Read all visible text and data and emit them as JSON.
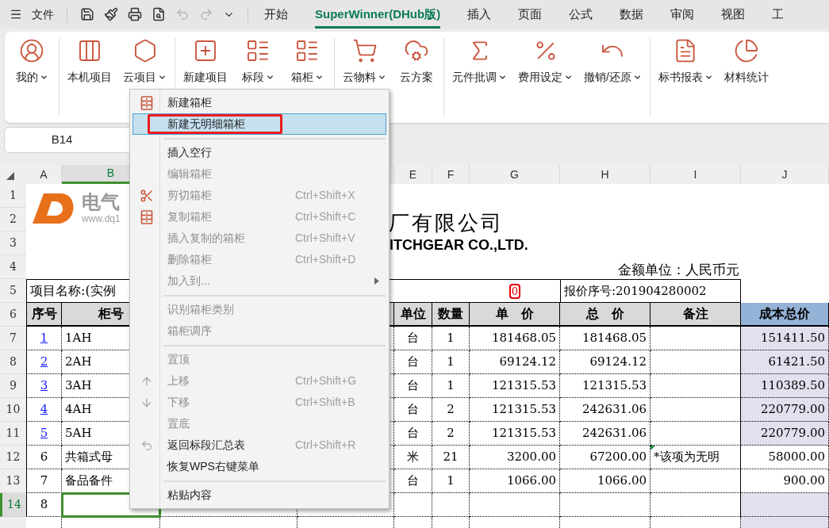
{
  "topbar": {
    "file_menu": "文件",
    "quick_actions": [
      {
        "disabled": false
      },
      {
        "disabled": false
      },
      {
        "disabled": false
      },
      {
        "disabled": false
      },
      {
        "disabled": true
      },
      {
        "disabled": true
      },
      {
        "disabled": false
      }
    ],
    "tabs": [
      {
        "label": "开始",
        "selected": false
      },
      {
        "label": "SuperWinner(DHub版)",
        "selected": true
      },
      {
        "label": "插入",
        "selected": false
      },
      {
        "label": "页面",
        "selected": false
      },
      {
        "label": "公式",
        "selected": false
      },
      {
        "label": "数据",
        "selected": false
      },
      {
        "label": "审阅",
        "selected": false
      },
      {
        "label": "视图",
        "selected": false
      },
      {
        "label": "工",
        "selected": false
      }
    ]
  },
  "ribbon": {
    "groups": [
      {
        "buttons": [
          {
            "label": "我的",
            "dropdown": true
          }
        ]
      },
      {
        "buttons": [
          {
            "label": "本机项目",
            "dropdown": false
          },
          {
            "label": "云项目",
            "dropdown": true
          }
        ]
      },
      {
        "buttons": [
          {
            "label": "新建项目",
            "dropdown": false
          },
          {
            "label": "标段",
            "dropdown": true
          },
          {
            "label": "箱柜",
            "dropdown": true
          }
        ]
      },
      {
        "buttons": [
          {
            "label": "云物料",
            "dropdown": true
          },
          {
            "label": "云方案",
            "dropdown": false
          }
        ]
      },
      {
        "buttons": [
          {
            "label": "元件批调",
            "dropdown": true
          },
          {
            "label": "费用设定",
            "dropdown": true
          },
          {
            "label": "撤销/还原",
            "dropdown": true
          }
        ]
      },
      {
        "buttons": [
          {
            "label": "标书报表",
            "dropdown": true
          },
          {
            "label": "材料统计",
            "dropdown": false
          }
        ]
      }
    ]
  },
  "name_box": "B14",
  "sheet": {
    "columns": [
      {
        "label": "A",
        "selected": false
      },
      {
        "label": "B",
        "selected": true
      },
      {
        "label": "E",
        "selected": false
      },
      {
        "label": "F",
        "selected": false
      },
      {
        "label": "G",
        "selected": false
      },
      {
        "label": "H",
        "selected": false
      },
      {
        "label": "I",
        "selected": false
      },
      {
        "label": "J",
        "selected": false
      }
    ],
    "row_numbers": [
      {
        "label": "1",
        "selected": false
      },
      {
        "label": "2",
        "selected": false
      },
      {
        "label": "3",
        "selected": false
      },
      {
        "label": "4",
        "selected": false
      },
      {
        "label": "5",
        "selected": false
      },
      {
        "label": "6",
        "selected": false
      },
      {
        "label": "7",
        "selected": false
      },
      {
        "label": "8",
        "selected": false
      },
      {
        "label": "9",
        "selected": false
      },
      {
        "label": "10",
        "selected": false
      },
      {
        "label": "11",
        "selected": false
      },
      {
        "label": "12",
        "selected": false
      },
      {
        "label": "13",
        "selected": false
      },
      {
        "label": "14",
        "selected": true
      }
    ],
    "title_block": {
      "logo_name": "电气",
      "logo_site": "www.dq1",
      "company_cn": "厂有限公司",
      "company_en": "ITCHGEAR CO.,LTD.",
      "currency_note": "金额单位：人民币元",
      "project_label": "项目名称:(实例",
      "marker": "0",
      "quote_no": "报价序号:201904280002"
    },
    "table": {
      "headers": [
        "序号",
        "柜号",
        "单位",
        "数量",
        "单　价",
        "总　价",
        "备注",
        "成本总价"
      ],
      "rows": [
        {
          "no": "1",
          "link": true,
          "name": "1AH",
          "unit": "台",
          "qty": "1",
          "price": "181468.05",
          "total": "181468.05",
          "cost": "151411.50",
          "shaded": true,
          "flag": false,
          "selected": false
        },
        {
          "no": "2",
          "link": true,
          "name": "2AH",
          "unit": "台",
          "qty": "1",
          "price": "69124.12",
          "total": "69124.12",
          "cost": "61421.50",
          "shaded": true,
          "flag": false,
          "selected": false
        },
        {
          "no": "3",
          "link": true,
          "name": "3AH",
          "unit": "台",
          "qty": "1",
          "price": "121315.53",
          "total": "121315.53",
          "cost": "110389.50",
          "shaded": true,
          "flag": false,
          "selected": false
        },
        {
          "no": "4",
          "link": true,
          "name": "4AH",
          "unit": "台",
          "qty": "2",
          "price": "121315.53",
          "total": "242631.06",
          "cost": "220779.00",
          "shaded": true,
          "flag": false,
          "selected": false
        },
        {
          "no": "5",
          "link": true,
          "name": "5AH",
          "unit": "台",
          "qty": "2",
          "price": "121315.53",
          "total": "242631.06",
          "cost": "220779.00",
          "shaded": true,
          "flag": false,
          "selected": false
        },
        {
          "no": "6",
          "link": false,
          "name": "共箱式母",
          "unit": "米",
          "qty": "21",
          "price": "3200.00",
          "total": "67200.00",
          "note": "*该项为无明",
          "cost": "58000.00",
          "shaded": false,
          "flag": true,
          "selected": false
        },
        {
          "no": "7",
          "link": false,
          "name": "备品备件",
          "unit": "台",
          "qty": "1",
          "price": "1066.00",
          "total": "1066.00",
          "cost": "900.00",
          "shaded": false,
          "flag": false,
          "selected": false
        },
        {
          "no": "8",
          "link": false,
          "shaded": true,
          "flag": false,
          "selected": true
        }
      ]
    }
  },
  "context_menu": {
    "items": [
      {
        "kind": "item",
        "label": "新建箱柜",
        "disabled": false,
        "selected": false,
        "annotated": false
      },
      {
        "kind": "item",
        "label": "新建无明细箱柜",
        "disabled": false,
        "selected": true,
        "annotated": true
      },
      {
        "kind": "separator"
      },
      {
        "kind": "item",
        "label": "插入空行",
        "disabled": false,
        "selected": false,
        "annotated": false
      },
      {
        "kind": "item",
        "label": "编辑箱柜",
        "disabled": true,
        "selected": false,
        "annotated": false
      },
      {
        "kind": "item",
        "label": "剪切箱柜",
        "shortcut": "Ctrl+Shift+X",
        "disabled": true,
        "selected": false,
        "annotated": false
      },
      {
        "kind": "item",
        "label": "复制箱柜",
        "shortcut": "Ctrl+Shift+C",
        "disabled": true,
        "selected": false,
        "annotated": false
      },
      {
        "kind": "item",
        "label": "插入复制的箱柜",
        "shortcut": "Ctrl+Shift+V",
        "disabled": true,
        "selected": false,
        "annotated": false
      },
      {
        "kind": "item",
        "label": "删除箱柜",
        "shortcut": "Ctrl+Shift+D",
        "disabled": true,
        "selected": false,
        "annotated": false
      },
      {
        "kind": "item",
        "label": "加入到...",
        "disabled": true,
        "selected": false,
        "annotated": false,
        "submenu": true
      },
      {
        "kind": "separator"
      },
      {
        "kind": "item",
        "label": "识别箱柜类别",
        "disabled": true,
        "selected": false,
        "annotated": false
      },
      {
        "kind": "item",
        "label": "箱柜调序",
        "disabled": true,
        "selected": false,
        "annotated": false
      },
      {
        "kind": "separator"
      },
      {
        "kind": "item",
        "label": "置顶",
        "disabled": true,
        "selected": false,
        "annotated": false
      },
      {
        "kind": "item",
        "label": "上移",
        "shortcut": "Ctrl+Shift+G",
        "disabled": true,
        "selected": false,
        "annotated": false
      },
      {
        "kind": "item",
        "label": "下移",
        "shortcut": "Ctrl+Shift+B",
        "disabled": true,
        "selected": false,
        "annotated": false
      },
      {
        "kind": "item",
        "label": "置底",
        "disabled": true,
        "selected": false,
        "annotated": false
      },
      {
        "kind": "item",
        "label": "返回标段汇总表",
        "shortcut": "Ctrl+Shift+R",
        "disabled": false,
        "selected": false,
        "annotated": false
      },
      {
        "kind": "item",
        "label": "恢复WPS右键菜单",
        "disabled": false,
        "selected": false,
        "annotated": false
      },
      {
        "kind": "separator"
      },
      {
        "kind": "item",
        "label": "粘贴内容",
        "disabled": false,
        "selected": false,
        "annotated": false
      }
    ]
  }
}
